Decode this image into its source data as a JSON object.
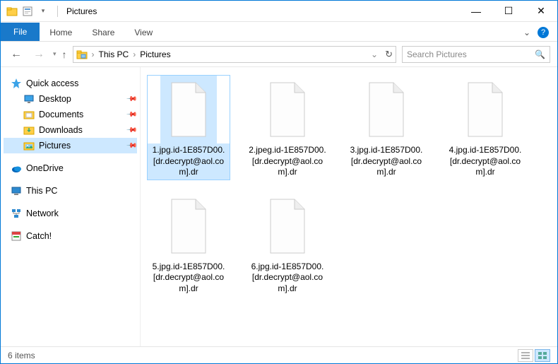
{
  "title": "Pictures",
  "titlebar": {
    "minimize": "—",
    "maximize": "☐",
    "close": "✕"
  },
  "ribbon": {
    "file": "File",
    "tabs": [
      "Home",
      "Share",
      "View"
    ]
  },
  "breadcrumb": {
    "root": "This PC",
    "current": "Pictures"
  },
  "search": {
    "placeholder": "Search Pictures"
  },
  "nav": {
    "quick": "Quick access",
    "quick_items": [
      {
        "label": "Desktop",
        "pinned": true
      },
      {
        "label": "Documents",
        "pinned": true
      },
      {
        "label": "Downloads",
        "pinned": true
      },
      {
        "label": "Pictures",
        "pinned": true,
        "selected": true
      }
    ],
    "onedrive": "OneDrive",
    "thispc": "This PC",
    "network": "Network",
    "catch": "Catch!"
  },
  "files": [
    {
      "name": "1.jpg.id-1E857D00.[dr.decrypt@aol.com].dr",
      "selected": true
    },
    {
      "name": "2.jpeg.id-1E857D00.[dr.decrypt@aol.com].dr"
    },
    {
      "name": "3.jpg.id-1E857D00.[dr.decrypt@aol.com].dr"
    },
    {
      "name": "4.jpg.id-1E857D00.[dr.decrypt@aol.com].dr"
    },
    {
      "name": "5.jpg.id-1E857D00.[dr.decrypt@aol.com].dr"
    },
    {
      "name": "6.jpg.id-1E857D00.[dr.decrypt@aol.com].dr"
    }
  ],
  "status": {
    "count": "6 items"
  }
}
